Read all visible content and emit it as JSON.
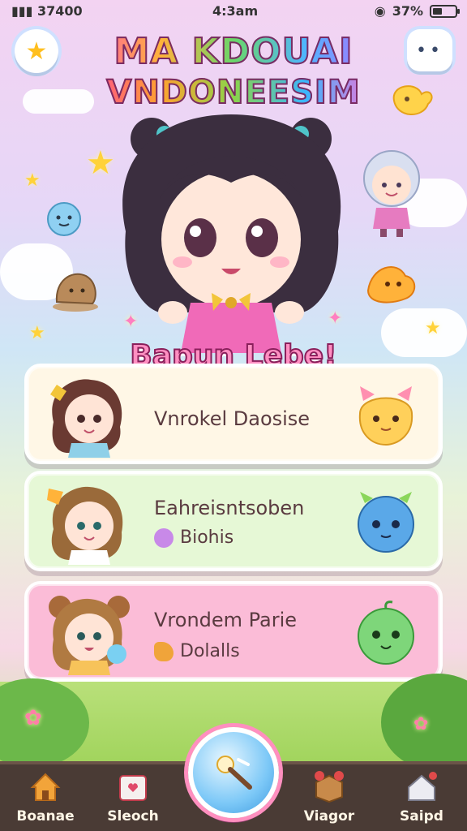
{
  "status_bar": {
    "left": "37400",
    "time": "4:3am",
    "battery": "37%",
    "battery_level": 0.37
  },
  "header": {
    "title_line1": "MA KDOUAI",
    "title_line2": "VNDONEESIM",
    "left_button_icon": "star-icon",
    "right_button_icon": "menu-dots-icon"
  },
  "banner": "Bapun Lebe!",
  "cards": [
    {
      "name": "Vnrokel Daosise",
      "sub": "",
      "gem_color": ""
    },
    {
      "name": "Eahreisntsoben",
      "sub": "Biohis",
      "gem_color": "#c889e8"
    },
    {
      "name": "Vrondem Parie",
      "sub": "Dolalls",
      "gem_color": "#f0a43a"
    }
  ],
  "nav": {
    "items": [
      {
        "label": "Boanae",
        "icon": "home-icon"
      },
      {
        "label": "Sleoch",
        "icon": "shop-icon"
      },
      {
        "label": "Viagor",
        "icon": "box-icon"
      },
      {
        "label": "Saipd",
        "icon": "house-icon"
      }
    ],
    "center_icon": "magic-wand-icon"
  },
  "colors": {
    "accent": "#ff8fc2",
    "nav_bg": "#4a3b35",
    "card1": "#fff7e6",
    "card2": "#e6f8d6",
    "card3": "#fbbcd7"
  }
}
